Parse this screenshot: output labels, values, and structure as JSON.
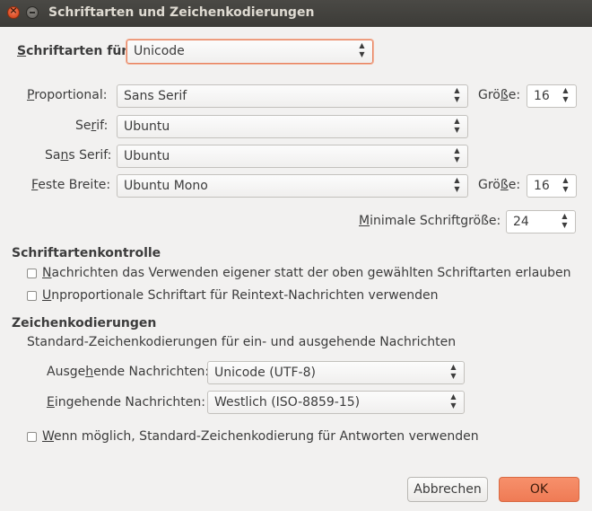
{
  "window": {
    "title": "Schriftarten und Zeichenkodierungen",
    "close_glyph": "×"
  },
  "fonts_for": {
    "label_pre": "",
    "label_u": "S",
    "label_post": "chriftarten für",
    "value": "Unicode"
  },
  "proportional": {
    "label_u": "P",
    "label_post": "roportional:",
    "value": "Sans Serif",
    "size_label_pre": "Grö",
    "size_label_u": "ß",
    "size_label_post": "e:",
    "size_value": "16"
  },
  "serif": {
    "label_pre": "Se",
    "label_u": "r",
    "label_post": "if:",
    "value": "Ubuntu"
  },
  "sans_serif": {
    "label_pre": "Sa",
    "label_u": "n",
    "label_post": "s Serif:",
    "value": "Ubuntu"
  },
  "fixed_width": {
    "label_u": "F",
    "label_post": "este Breite:",
    "value": "Ubuntu Mono",
    "size_label_pre": "Grö",
    "size_label_u": "ß",
    "size_label_post": "e:",
    "size_value": "16"
  },
  "min_size": {
    "label_u": "M",
    "label_post": "inimale Schriftgröße:",
    "value": "24"
  },
  "font_control": {
    "heading": "Schriftartenkontrolle",
    "allow_own_fonts": {
      "label_u": "N",
      "label_post": "achrichten das Verwenden eigener statt der oben gewählten Schriftarten erlauben",
      "checked": false
    },
    "monospace_plaintext": {
      "label_u": "U",
      "label_post": "nproportionale Schriftart für Reintext-Nachrichten verwenden",
      "checked": false
    }
  },
  "encodings": {
    "heading": "Zeichenkodierungen",
    "description": "Standard-Zeichenkodierungen für ein- und ausgehende Nachrichten",
    "outgoing": {
      "label_pre": "Ausge",
      "label_u": "h",
      "label_post": "ende Nachrichten:",
      "value": "Unicode (UTF-8)"
    },
    "incoming": {
      "label_u": "E",
      "label_post": "ingehende Nachrichten:",
      "value": "Westlich (ISO-8859-15)"
    },
    "use_default_for_replies": {
      "label_u": "W",
      "label_post": "enn möglich, Standard-Zeichenkodierung für Antworten verwenden",
      "checked": false
    }
  },
  "buttons": {
    "cancel": "Abbrechen",
    "ok": "OK"
  },
  "colors": {
    "accent": "#ef7b55",
    "titlebar": "#3c3b37",
    "background": "#f2f1f0"
  }
}
